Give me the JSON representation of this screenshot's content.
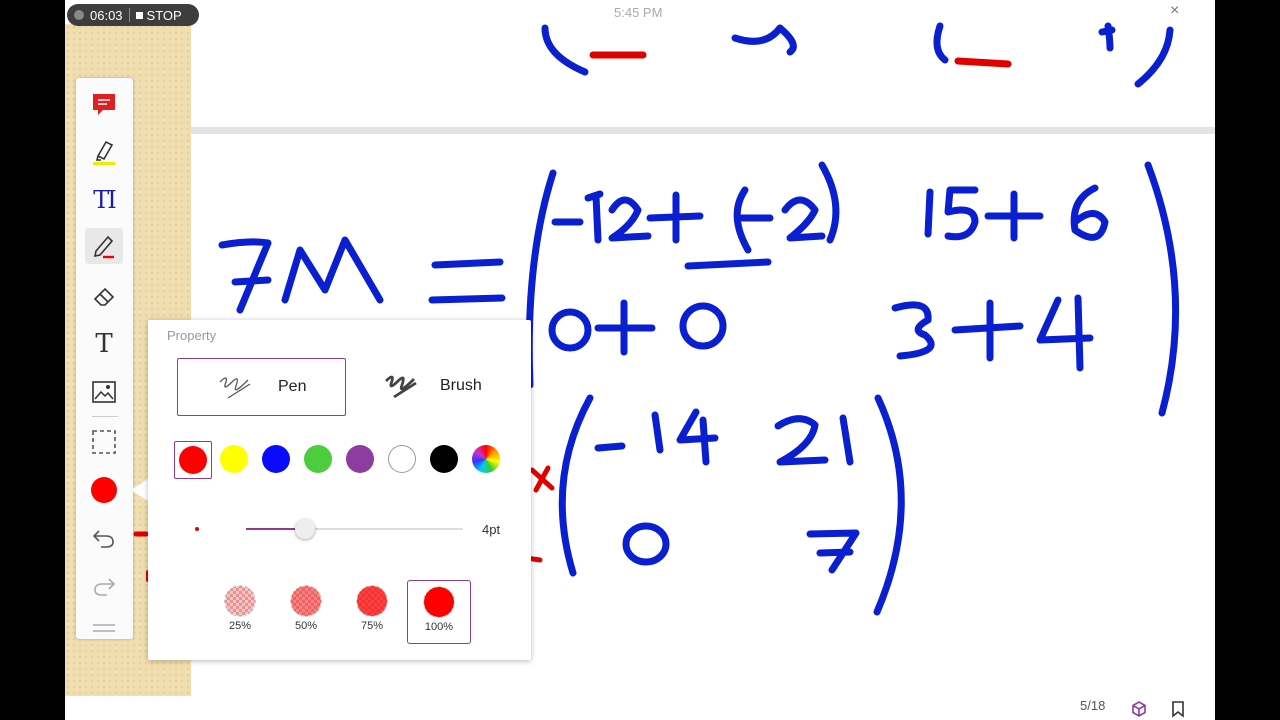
{
  "recording": {
    "elapsed": "06:03",
    "stop_label": "STOP"
  },
  "status": {
    "time": "5:45 PM",
    "close": "×"
  },
  "ink": {
    "color": "#0a1fd0",
    "accent": "#e00000"
  },
  "toolbar": {
    "icons": [
      "comment-icon",
      "highlighter-icon",
      "text-select-icon",
      "pen-icon",
      "eraser-icon",
      "text-icon",
      "image-icon",
      "lasso-select-icon",
      "color-icon",
      "undo-icon",
      "redo-icon",
      "more-icon"
    ],
    "current_color": "#ff0000",
    "text_select_glyph": "TI",
    "text_glyph": "T"
  },
  "property_panel": {
    "title": "Property",
    "tools": [
      {
        "label": "Pen",
        "selected": true
      },
      {
        "label": "Brush",
        "selected": false
      }
    ],
    "colors": [
      "#ff0000",
      "#ffff00",
      "#0a0aff",
      "#4dcc3e",
      "#8d3c9f",
      "#ffffff",
      "#000000",
      "multicolor"
    ],
    "selected_color_index": 0,
    "stroke_size": {
      "label": "4pt",
      "value_fraction": 0.27
    },
    "opacity_options": [
      {
        "label": "25%",
        "value": 0.25
      },
      {
        "label": "50%",
        "value": 0.5
      },
      {
        "label": "75%",
        "value": 0.75
      },
      {
        "label": "100%",
        "value": 1.0
      }
    ],
    "selected_opacity_index": 3
  },
  "footer": {
    "page": "5/18"
  }
}
